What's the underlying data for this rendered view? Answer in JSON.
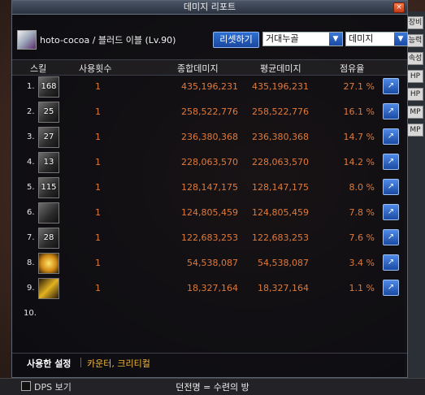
{
  "window": {
    "title": "데미지 리포트"
  },
  "character": {
    "name": "hoto-cocoa / 블러드 이블 (Lv.90)"
  },
  "toolbar": {
    "reset_label": "리셋하기",
    "mode_select": "거대누골",
    "metric_select": "데미지"
  },
  "columns": {
    "skill": "스킬",
    "count": "사용횟수",
    "total": "종합데미지",
    "avg": "평균데미지",
    "share": "점유율"
  },
  "rows": [
    {
      "index": "1.",
      "icon_text": "168",
      "count": "1",
      "total": "435,196,231",
      "avg": "435,196,231",
      "share": "27.1 %"
    },
    {
      "index": "2.",
      "icon_text": "25",
      "count": "1",
      "total": "258,522,776",
      "avg": "258,522,776",
      "share": "16.1 %"
    },
    {
      "index": "3.",
      "icon_text": "27",
      "count": "1",
      "total": "236,380,368",
      "avg": "236,380,368",
      "share": "14.7 %"
    },
    {
      "index": "4.",
      "icon_text": "13",
      "count": "1",
      "total": "228,063,570",
      "avg": "228,063,570",
      "share": "14.2 %"
    },
    {
      "index": "5.",
      "icon_text": "115",
      "count": "1",
      "total": "128,147,175",
      "avg": "128,147,175",
      "share": "8.0 %"
    },
    {
      "index": "6.",
      "icon_text": "",
      "count": "1",
      "total": "124,805,459",
      "avg": "124,805,459",
      "share": "7.8 %"
    },
    {
      "index": "7.",
      "icon_text": "28",
      "count": "1",
      "total": "122,683,253",
      "avg": "122,683,253",
      "share": "7.6 %"
    },
    {
      "index": "8.",
      "icon_text": "",
      "count": "1",
      "total": "54,538,087",
      "avg": "54,538,087",
      "share": "3.4 %"
    },
    {
      "index": "9.",
      "icon_text": "",
      "count": "1",
      "total": "18,327,164",
      "avg": "18,327,164",
      "share": "1.1 %"
    }
  ],
  "empty_row": {
    "index": "10."
  },
  "tabs": {
    "used": "사용한 설정",
    "extra": "카운터, 크리티컬"
  },
  "status": {
    "dps_label": "DPS 보기",
    "dungeon": "던전명 = 수련의 방"
  },
  "side_buttons": [
    "장비",
    "능력",
    "속성",
    "HP",
    "HP",
    "MP",
    "MP"
  ]
}
